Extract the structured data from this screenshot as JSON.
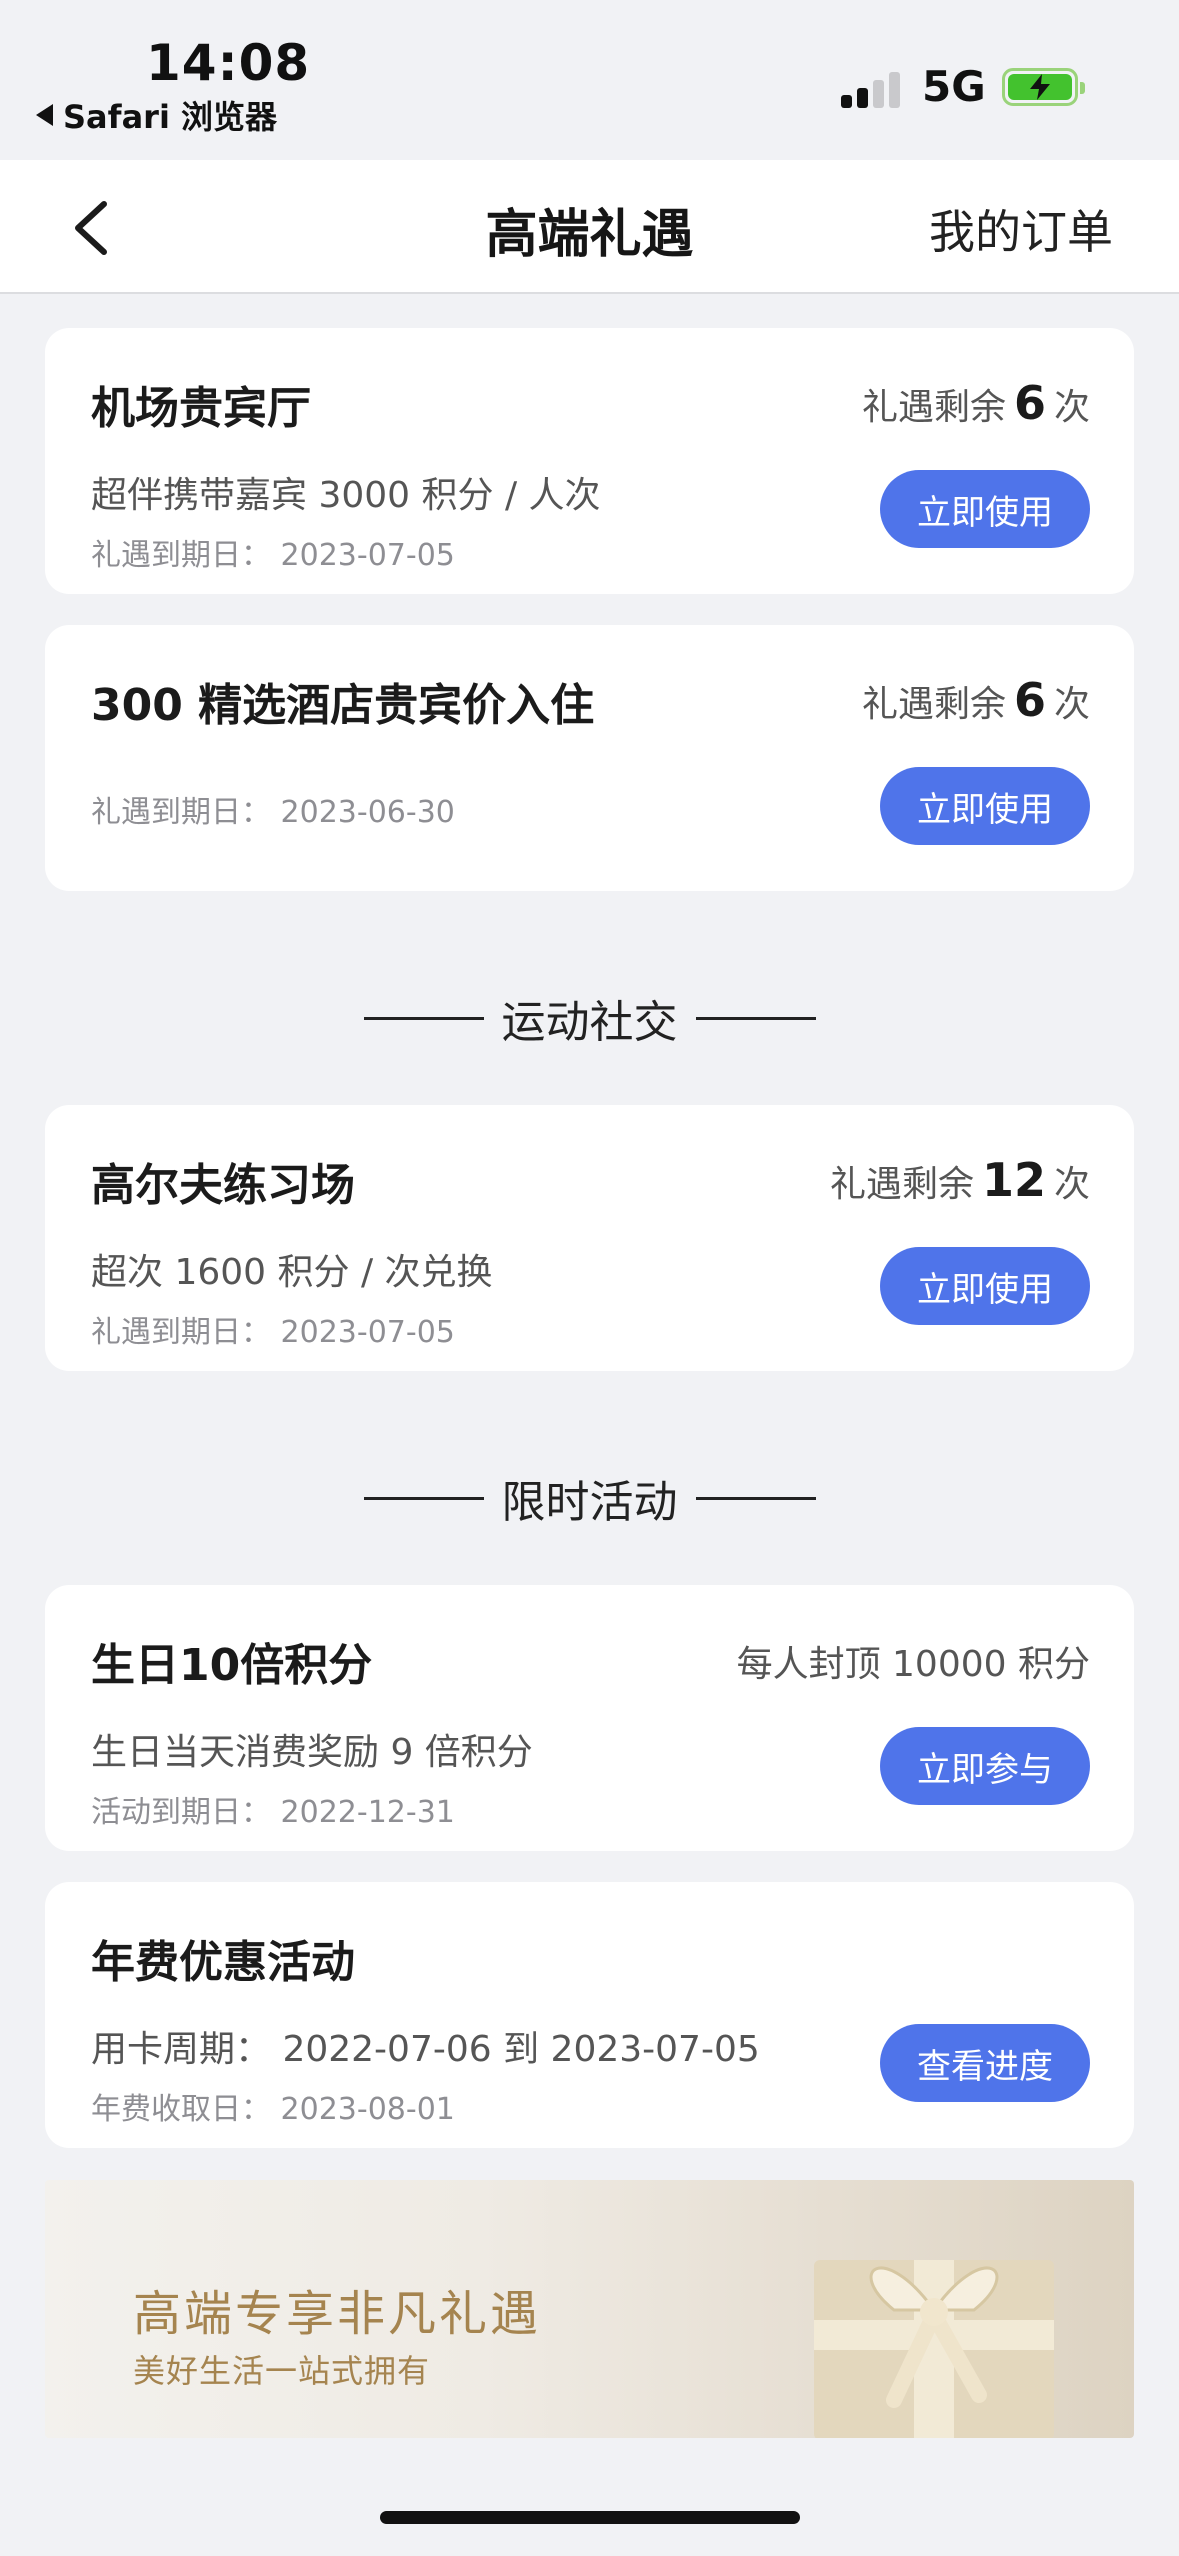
{
  "status_bar": {
    "time": "14:08",
    "back_app": "Safari 浏览器",
    "network": "5G",
    "signal_bars_active": 2,
    "battery_state": "charging"
  },
  "nav": {
    "title": "高端礼遇",
    "right_link": "我的订单"
  },
  "cards_top": [
    {
      "title": "机场贵宾厅",
      "remaining_prefix": "礼遇剩余",
      "remaining_count": "6",
      "remaining_suffix": "次",
      "desc": "超伴携带嘉宾 3000 积分 / 人次",
      "date": "礼遇到期日：  2023-07-05",
      "button": "立即使用"
    },
    {
      "title": "300 精选酒店贵宾价入住",
      "remaining_prefix": "礼遇剩余",
      "remaining_count": "6",
      "remaining_suffix": "次",
      "desc": "",
      "date": "礼遇到期日：  2023-06-30",
      "button": "立即使用"
    }
  ],
  "sections": {
    "sports": "运动社交",
    "limited": "限时活动"
  },
  "card_golf": {
    "title": "高尔夫练习场",
    "remaining_prefix": "礼遇剩余",
    "remaining_count": "12",
    "remaining_suffix": "次",
    "desc": "超次 1600 积分 / 次兑换",
    "date": "礼遇到期日：  2023-07-05",
    "button": "立即使用"
  },
  "card_birthday": {
    "title": "生日10倍积分",
    "cap": "每人封顶 10000 积分",
    "desc": "生日当天消费奖励 9 倍积分",
    "date": "活动到期日：  2022-12-31",
    "button": "立即参与"
  },
  "card_fee": {
    "title": "年费优惠活动",
    "desc": "用卡周期：  2022-07-06 到 2023-07-05",
    "date": "年费收取日：  2023-08-01",
    "button": "查看进度"
  },
  "banner": {
    "title": "高端专享非凡礼遇",
    "subtitle": "美好生活一站式拥有"
  },
  "colors": {
    "accent": "#4f74ea",
    "background": "#f1f2f5",
    "banner_text": "#a5844f"
  }
}
